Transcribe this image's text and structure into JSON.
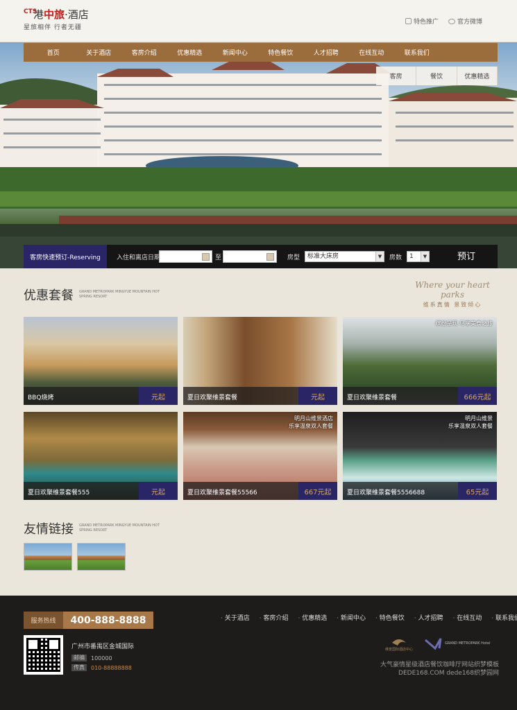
{
  "header": {
    "logo_cts": "CTS",
    "logo_prefix": "港",
    "logo_brand": "中旅",
    "logo_suffix": "·酒店",
    "logo_slogan": "星旅相伴  行者无疆",
    "links": [
      "特色推广",
      "官方微博"
    ]
  },
  "nav": {
    "items": [
      "首页",
      "关于酒店",
      "客房介绍",
      "优惠精选",
      "新闻中心",
      "特色餐饮",
      "人才招聘",
      "在线互动",
      "联系我们"
    ]
  },
  "side_tabs": [
    "客房",
    "餐饮",
    "优惠精选"
  ],
  "reservation": {
    "label": "客房快速预订-Reserving",
    "checkin_label": "入住和离店日期",
    "to_label": "至",
    "room_type_label": "房型",
    "room_type_value": "标准大床房",
    "rooms_label": "房数",
    "rooms_value": "1",
    "submit": "预订"
  },
  "offers": {
    "title": "优惠套餐",
    "subtitle_en": "GRAND METROPARK MINGYUE MOUNTAIN HOT SPRING RESORT",
    "tagline_script": "Where your heart parks",
    "tagline_cn": "维系真情  景致倾心",
    "cards": [
      {
        "name": "BBQ烧烤",
        "price": "元起",
        "overlay": ""
      },
      {
        "name": "夏日欢聚维景套餐",
        "price": "元起",
        "overlay": ""
      },
      {
        "name": "夏日欢聚维景套餐",
        "price": "666元起",
        "overlay": "缤纷呈现 尽享美食之旅"
      },
      {
        "name": "夏日欢聚维景套餐555",
        "price": "元起",
        "overlay": ""
      },
      {
        "name": "夏日欢聚维景套餐55566",
        "price": "667元起",
        "overlay": "明月山维景酒店\n乐享温泉双人套餐"
      },
      {
        "name": "夏日欢聚维景套餐5556688",
        "price": "65元起",
        "overlay": "明月山维景\n乐享温泉双人套餐"
      }
    ]
  },
  "links_section": {
    "title": "友情链接",
    "subtitle_en": "GRAND METROPARK MINGYUE MOUNTAIN HOT SPRING RESORT"
  },
  "footer": {
    "hotline_label": "服务热线",
    "hotline": "400-888-8888",
    "nav": [
      "关于酒店",
      "客房介绍",
      "优惠精选",
      "新闻中心",
      "特色餐饮",
      "人才招聘",
      "在线互动",
      "联系我们"
    ],
    "address": "广州市番禺区金城国际",
    "zip_label": "邮编",
    "zip": "100000",
    "fax_label": "传真",
    "fax": "010-88888888",
    "partner_logos": [
      "维景国际酒店中心",
      "GRAND METROPARK Hotel"
    ],
    "copyright_1": "大气豪情星级酒店餐饮咖啡厅网站织梦模板",
    "copyright_2": "DEDE168.COM dede168织梦园网"
  },
  "colors": {
    "nav_brown": "#9b6c3c",
    "accent_purple": "#2a2564",
    "price_gold": "#d6a86a",
    "hotline_bg": "#a87848",
    "footer_bg": "#1e1c1b"
  }
}
